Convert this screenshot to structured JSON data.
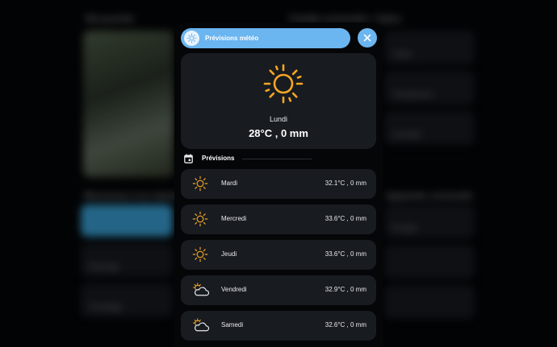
{
  "background": {
    "left_title": "Ma journée",
    "right_title": "Famille connectée • Salon",
    "left_section_title": "Bienvenue à la maison",
    "right_section_title": "Appareils connectés",
    "tiles": [
      "Éclairage",
      "Chauffage",
      "Volets",
      "Température",
      "Humidité",
      "Énergie"
    ]
  },
  "modal": {
    "title": "Prévisions météo",
    "today": {
      "day": "Lundi",
      "value": "28°C , 0 mm",
      "icon": "sun-icon"
    },
    "forecast_title": "Prévisions",
    "days": [
      {
        "name": "Mardi",
        "value": "32.1°C , 0 mm",
        "icon": "sun-icon"
      },
      {
        "name": "Mercredi",
        "value": "33.6°C , 0 mm",
        "icon": "sun-icon"
      },
      {
        "name": "Jeudi",
        "value": "33.6°C , 0 mm",
        "icon": "sun-icon"
      },
      {
        "name": "Vendredi",
        "value": "32.9°C , 0 mm",
        "icon": "partly-cloudy-icon"
      },
      {
        "name": "Samedi",
        "value": "32.6°C , 0 mm",
        "icon": "partly-cloudy-icon"
      }
    ]
  },
  "colors": {
    "accent": "#6bb5f0",
    "sun": "#f5a623",
    "card": "#181b20"
  }
}
